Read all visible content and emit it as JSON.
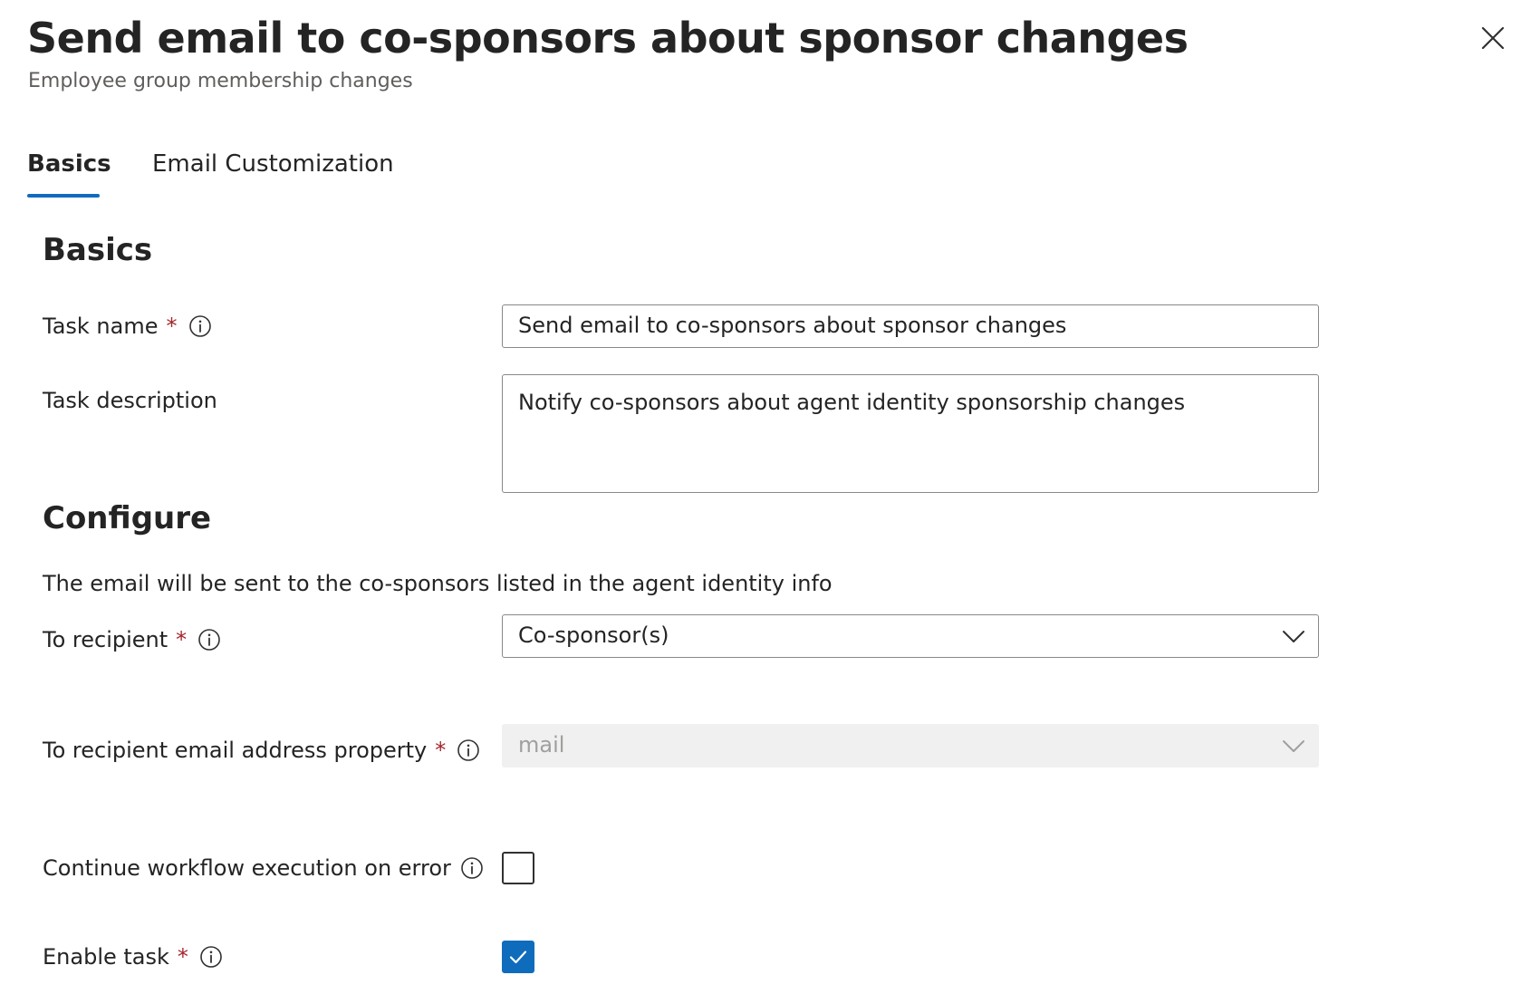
{
  "header": {
    "title": "Send email to co-sponsors about sponsor changes",
    "subtitle": "Employee group membership changes",
    "close_icon": "close-icon"
  },
  "tabs": [
    {
      "label": "Basics",
      "active": true
    },
    {
      "label": "Email Customization",
      "active": false
    }
  ],
  "basics": {
    "heading": "Basics",
    "task_name": {
      "label": "Task name",
      "required": "*",
      "value": "Send email to co-sponsors about sponsor changes"
    },
    "task_description": {
      "label": "Task description",
      "value": "Notify co-sponsors about agent identity sponsorship changes"
    }
  },
  "configure": {
    "heading": "Configure",
    "helper_text": "The email will be sent to the co-sponsors listed in the agent identity info",
    "to_recipient": {
      "label": "To recipient",
      "required": "*",
      "selected": "Co-sponsor(s)"
    },
    "email_property": {
      "label": "To recipient email address property",
      "required": "*",
      "selected": "mail",
      "disabled": true
    },
    "continue_on_error": {
      "label": "Continue workflow execution on error",
      "checked": false
    },
    "enable_task": {
      "label": "Enable task",
      "required": "*",
      "checked": true
    }
  },
  "colors": {
    "accent": "#0f6cbd",
    "required": "#a4262c",
    "text": "#242424",
    "subtle_text": "#605e5c",
    "disabled_bg": "#f0f0f0",
    "disabled_text": "#a19f9d",
    "border": "#8a8886"
  }
}
